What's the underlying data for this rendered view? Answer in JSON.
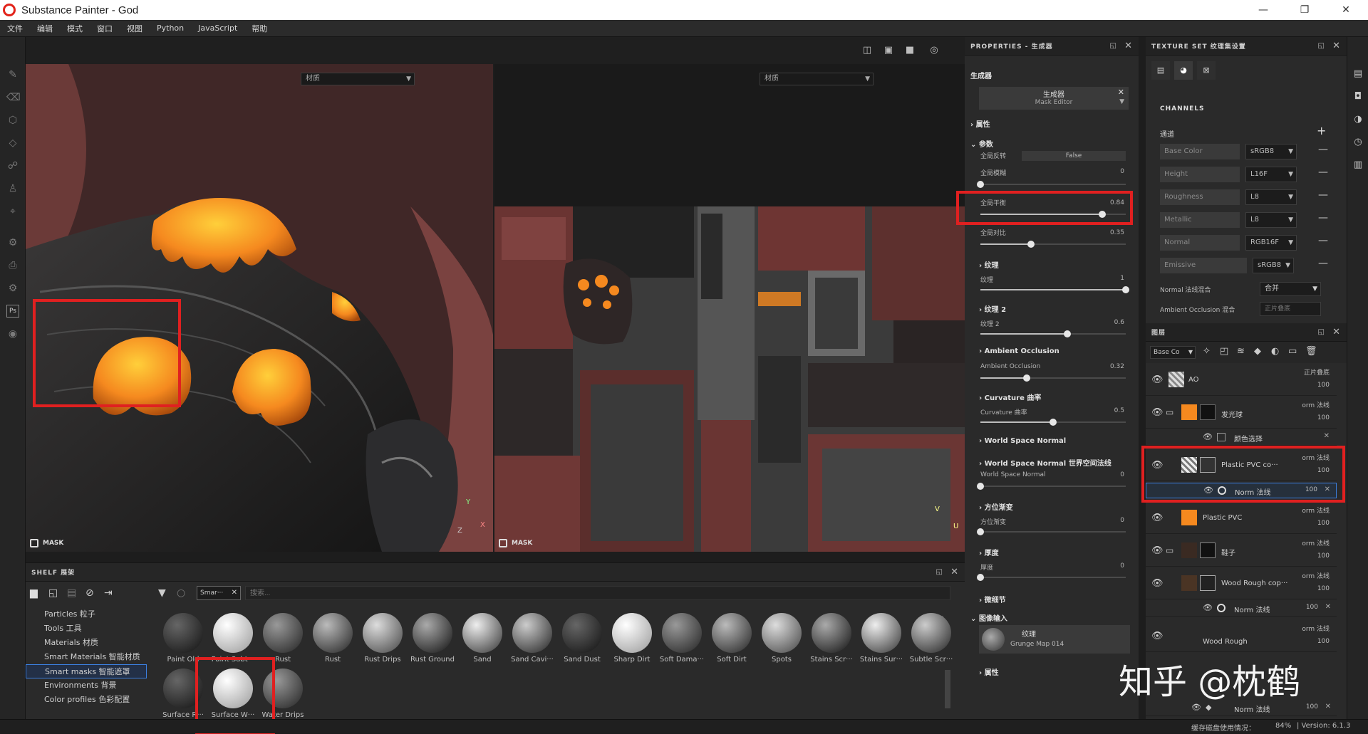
{
  "window": {
    "title": "Substance Painter - God",
    "minimize": "—",
    "restore": "❐",
    "close": "✕"
  },
  "menu": [
    "文件",
    "编辑",
    "模式",
    "窗口",
    "视图",
    "Python",
    "JavaScript",
    "帮助"
  ],
  "viewport": {
    "left_select": "材质",
    "right_select": "材质",
    "mask_label": "MASK",
    "axis_3d": {
      "y": "Y",
      "x": "X",
      "z": "Z"
    },
    "axis_2d": {
      "v": "V",
      "u": "U"
    }
  },
  "properties": {
    "title": "PROPERTIES - 生成器",
    "generator_label": "生成器",
    "generator_name": "生成器",
    "generator_sub": "Mask Editor",
    "section_attr": "属性",
    "section_params": "参数",
    "global_invert_label": "全局反转",
    "global_invert_value": "False",
    "global_blur_label": "全局模糊",
    "global_blur_value": "0",
    "global_balance_label": "全局平衡",
    "global_balance_value": "0.84",
    "global_contrast_label": "全局对比",
    "global_contrast_value": "0.35",
    "texture_section": "纹理",
    "texture_label": "纹理",
    "texture_value": "1",
    "texture2_section": "纹理 2",
    "texture2_label": "纹理 2",
    "texture2_value": "0.6",
    "ao_section": "Ambient Occlusion",
    "ao_label": "Ambient Occlusion",
    "ao_value": "0.32",
    "curv_section": "Curvature 曲率",
    "curv_label": "Curvature 曲率",
    "curv_value": "0.5",
    "wsn_section": "World Space Normal",
    "wsn2_section": "World Space Normal 世界空间法线",
    "wsn_label": "World Space Normal",
    "wsn_value": "0",
    "dir_section": "方位渐变",
    "dir_label": "方位渐变",
    "dir_value": "0",
    "thick_section": "厚度",
    "thick_label": "厚度",
    "thick_value": "0",
    "detail_section": "微细节",
    "image_input_section": "图像输入",
    "image_input_label": "纹理",
    "image_input_value": "Grunge Map 014",
    "attr2_section": "属性",
    "values": {
      "global_blur": 0,
      "global_balance": 0.84,
      "global_contrast": 0.35,
      "texture": 1,
      "texture2": 0.6,
      "ao": 0.32,
      "curv": 0.5,
      "wsn": 0,
      "dir": 0,
      "thick": 0
    }
  },
  "texture_set": {
    "title": "TEXTURE SET 纹理集设置",
    "channels_label": "CHANNELS",
    "channels_sub": "通道",
    "add": "+",
    "channels": [
      {
        "name": "Base Color",
        "format": "sRGB8"
      },
      {
        "name": "Height",
        "format": "L16F"
      },
      {
        "name": "Roughness",
        "format": "L8"
      },
      {
        "name": "Metallic",
        "format": "L8"
      },
      {
        "name": "Normal",
        "format": "RGB16F"
      },
      {
        "name": "Emissive",
        "format": "sRGB8"
      }
    ],
    "normal_mix_label": "Normal 法线混合",
    "normal_mix_value": "合并",
    "ao_mix_label": "Ambient Occlusion 混合",
    "ao_mix_value": "正片叠底"
  },
  "layers": {
    "title": "图层",
    "channel_select": "Base Co",
    "rows": [
      {
        "name": "AO",
        "blend": "正片叠底",
        "opacity": "100"
      },
      {
        "name": "发光球",
        "blend": "orm 法线",
        "opacity": "100"
      },
      {
        "name": "颜色选择"
      },
      {
        "name": "Plastic PVC co···",
        "blend": "orm 法线",
        "opacity": "100"
      },
      {
        "name": "Norm 法线",
        "opacity": "100"
      },
      {
        "name": "Plastic PVC",
        "blend": "orm 法线",
        "opacity": "100"
      },
      {
        "name": "鞋子",
        "blend": "orm 法线",
        "opacity": "100"
      },
      {
        "name": "Wood Rough cop···",
        "blend": "orm 法线",
        "opacity": "100"
      },
      {
        "name": "Norm 法线",
        "opacity": "100"
      },
      {
        "name": "Wood Rough",
        "blend": "orm 法线",
        "opacity": "100"
      },
      {
        "name": "Norm 法线",
        "opacity": "100"
      }
    ]
  },
  "shelf": {
    "title": "SHELF 展架",
    "filter_tag": "Smar···",
    "search_placeholder": "搜索...",
    "categories": [
      "Particles 粒子",
      "Tools 工具",
      "Materials 材质",
      "Smart Materials 智能材质",
      "Smart masks 智能遮罩",
      "Environments 背景",
      "Color profiles 色彩配置"
    ],
    "selected_category": "Smart masks 智能遮罩",
    "row1": [
      "Paint Old",
      "Paint Subt···",
      "Rust",
      "Rust",
      "Rust Drips",
      "Rust Ground",
      "Sand",
      "Sand Cavi···",
      "Sand Dust",
      "Sharp Dirt",
      "Soft Dama···",
      "Soft Dirt",
      "Spots",
      "Stains Scr···",
      "Stains Sur···",
      "Subtle Scr···"
    ],
    "row2": [
      "Surface R···",
      "Surface W···",
      "Water Drips"
    ]
  },
  "status": {
    "disk": "缓存磁盘使用情况：",
    "disk_value": "84%",
    "version": "| Version: 6.1.3"
  },
  "watermark": "知乎 @枕鹤",
  "colors": {
    "accent": "#3b7fe0",
    "highlight": "#e02020",
    "orange": "#f5891f"
  }
}
